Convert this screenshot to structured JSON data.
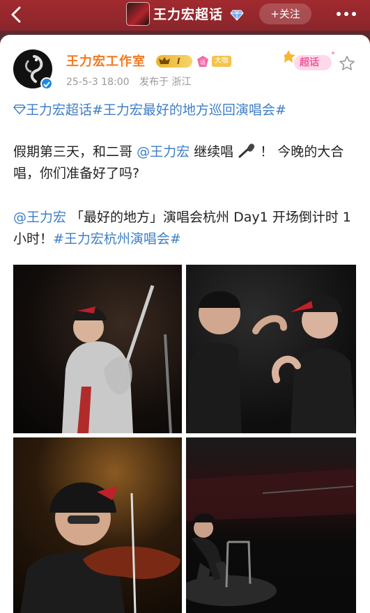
{
  "header": {
    "title": "王力宏超话",
    "follow_label": "+关注"
  },
  "post": {
    "username": "王力宏工作室",
    "vip_level": "I",
    "rank_badge": "大咖",
    "chaohua_tag": "超话",
    "date": "25-5-3 18:00",
    "location": "发布于 浙江",
    "topics_line": "王力宏超话#王力宏最好的地方巡回演唱会#",
    "para1_before": "假期第三天，和二哥",
    "para1_mention": "@王力宏",
    "para1_mid": " 继续唱",
    "para1_after": "！ 今晚的大合唱，你们准备好了吗?",
    "para2_mention": "@王力宏",
    "para2_text": " 「最好的地方」演唱会杭州 Day1 开场倒计时 1小时！",
    "para2_topic": "#王力宏杭州演唱会#"
  },
  "photos": [
    {
      "name": "photo-guitar"
    },
    {
      "name": "photo-talk"
    },
    {
      "name": "photo-violin"
    },
    {
      "name": "photo-seated"
    }
  ],
  "colors": {
    "header_bg": "#a12a2f",
    "username": "#f47a20",
    "link_blue": "#3d7ec6"
  }
}
